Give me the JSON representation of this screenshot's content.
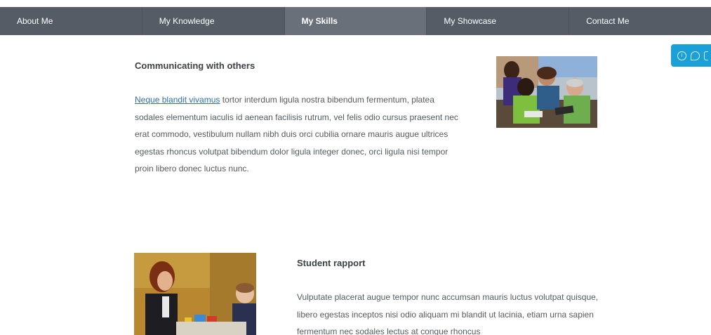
{
  "nav": {
    "items": [
      {
        "label": "About Me",
        "active": false
      },
      {
        "label": "My Knowledge",
        "active": false
      },
      {
        "label": "My Skills",
        "active": true
      },
      {
        "label": "My Showcase",
        "active": false
      },
      {
        "label": "Contact Me",
        "active": false
      }
    ]
  },
  "feedback_tab": {
    "icons": [
      "info-icon",
      "chat-icon",
      "more-icon"
    ],
    "color": "#1aa0d6"
  },
  "sections": [
    {
      "heading": "Communicating with others",
      "link_text": "Neque blandit vivamus",
      "body": " tortor interdum ligula nostra bibendum fermentum, platea sodales elementum iaculis id aenean facilisis rutrum, vel felis odio cursus praesent nec erat commodo, vestibulum nullam nibh duis orci cubilia ornare mauris augue ultrices egestas rhoncus volutpat bibendum dolor ligula integer donec, orci ligula nisi tempor proin libero donec luctus nunc."
    },
    {
      "heading": "Student rapport",
      "body": "Vulputate placerat augue tempor nunc accumsan mauris luctus volutpat quisque, libero egestas inceptos nisi odio aliquam mi blandit ut lacinia, etiam urna sapien fermentum nec sodales lectus at congue rhoncus"
    }
  ],
  "colors": {
    "nav_bg": "#565c66",
    "nav_active_bg": "#6a707a",
    "link": "#2f6fb0",
    "text": "#555a61",
    "heading": "#3d4046"
  }
}
